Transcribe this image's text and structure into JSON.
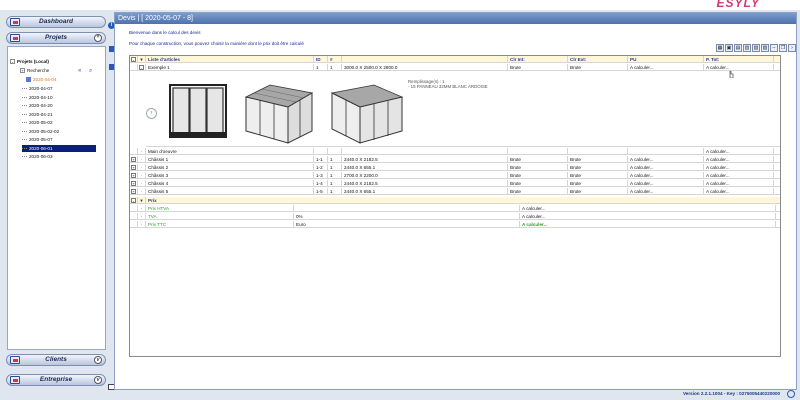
{
  "brand": "ESYLY",
  "sidebar": {
    "dashboard_label": "Dashboard",
    "projets_label": "Projets",
    "clients_label": "Clients",
    "entreprise_label": "Entreprise",
    "tree": {
      "root": "Projets (Local)",
      "search": "Recherche",
      "project": "2020-04-04",
      "dates": [
        "2020-04-07",
        "2020-04-10",
        "2020-04-20",
        "2020-04-21",
        "2020-05-02",
        "2020-05-02-02",
        "2020-05-07",
        "2020-06-01",
        "2020-06-03"
      ],
      "selected_index": 7
    }
  },
  "main": {
    "title": "Devis | [ 2020-05-07 - 8]",
    "intro_line1": "Bienvenue dans le calcul des devis",
    "intro_line2": "Pour chaque construction, vous pouvez choisir la manière dont le prix doit être calculé"
  },
  "grid": {
    "headers": {
      "label": "Liste d'articles",
      "id": "ID",
      "qty": "#",
      "int": "Clr Int:",
      "ext": "Clr Ext:",
      "pu": "PU",
      "ptot": "P. Tot:"
    },
    "example": {
      "label": "Exemple 1",
      "id": "1",
      "qty": "1",
      "dims": "3000.0 X  2500.0 X  2800.0",
      "int": "Brute",
      "ext": "Brute",
      "pu": "A calculer...",
      "ptot": "A calculer..."
    },
    "remplissage_line1": "Remplissage(s) : 1",
    "remplissage_line2": "- 15 PANNEAU 32MM BLANC ARDOISE",
    "main_oeuvre": {
      "label": "Main d'oeuvre",
      "ptot": "A calculer..."
    },
    "chassis": [
      {
        "label": "Châssis 1",
        "id": "1-1",
        "qty": "1",
        "dims": "2440.0 X  2182.5",
        "int": "Brute",
        "ext": "Brute",
        "pu": "A calculer...",
        "ptot": "A calculer..."
      },
      {
        "label": "Châssis 2",
        "id": "1-2",
        "qty": "1",
        "dims": "2440.0 X  655.1",
        "int": "Brute",
        "ext": "Brute",
        "pu": "A calculer...",
        "ptot": "A calculer..."
      },
      {
        "label": "Châssis 3",
        "id": "1-3",
        "qty": "1",
        "dims": "2700.0 X  2200.0",
        "int": "Brute",
        "ext": "Brute",
        "pu": "A calculer...",
        "ptot": "A calculer..."
      },
      {
        "label": "Châssis 4",
        "id": "1-4",
        "qty": "1",
        "dims": "2440.0 X  2182.5",
        "int": "Brute",
        "ext": "Brute",
        "pu": "A calculer...",
        "ptot": "A calculer..."
      },
      {
        "label": "Châssis 5",
        "id": "1-5",
        "qty": "1",
        "dims": "2440.0 X  655.1",
        "int": "Brute",
        "ext": "Brute",
        "pu": "A calculer...",
        "ptot": "A calculer..."
      }
    ],
    "prix": {
      "header": "Prix",
      "htva": {
        "label": "Prix HTVA",
        "rate": "",
        "value": "A calculer..."
      },
      "tva": {
        "label": "TVA",
        "rate": "0%",
        "value": "A calculer..."
      },
      "ttc": {
        "label": "Prix TTC",
        "rate": "Euro",
        "value": "A calculer..."
      }
    }
  },
  "footer": {
    "version": "Version 2.2.1.1004 - Key : 0275005440220000"
  }
}
